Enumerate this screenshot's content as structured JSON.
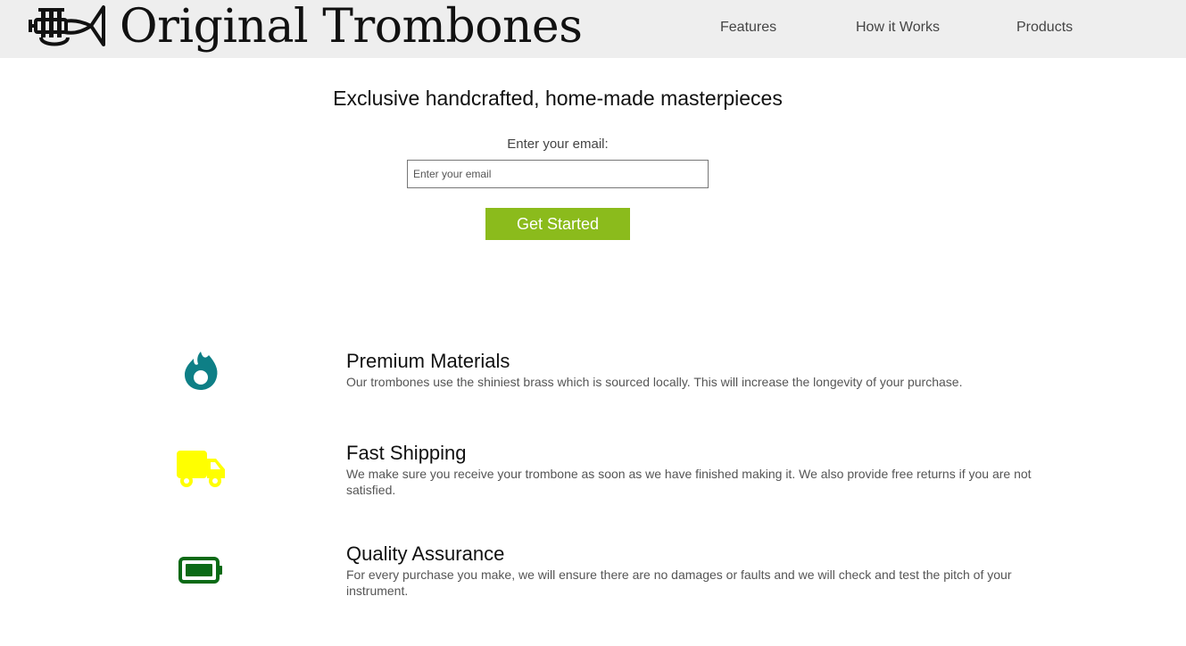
{
  "brand": {
    "name": "Original Trombones",
    "logo_icon": "trumpet-icon"
  },
  "nav": {
    "items": [
      {
        "label": "Features"
      },
      {
        "label": "How it Works"
      },
      {
        "label": "Products"
      }
    ]
  },
  "hero": {
    "title": "Exclusive handcrafted, home-made masterpieces",
    "email_label": "Enter your email:",
    "email_placeholder": "Enter your email",
    "email_value": "",
    "button_label": "Get Started"
  },
  "features": [
    {
      "icon": "fire-icon",
      "icon_color": "#0e7f86",
      "title": "Premium Materials",
      "description": "Our trombones use the shiniest brass which is sourced locally. This will increase the longevity of your purchase."
    },
    {
      "icon": "truck-icon",
      "icon_color": "#ffff00",
      "title": "Fast Shipping",
      "description": "We make sure you receive your trombone as soon as we have finished making it. We also provide free returns if you are not satisfied."
    },
    {
      "icon": "battery-icon",
      "icon_color": "#0b6a16",
      "title": "Quality Assurance",
      "description": "For every purchase you make, we will ensure there are no damages or faults and we will check and test the pitch of your instrument."
    }
  ],
  "colors": {
    "header_bg": "#eeeeee",
    "button_bg": "#8bbb1c"
  }
}
